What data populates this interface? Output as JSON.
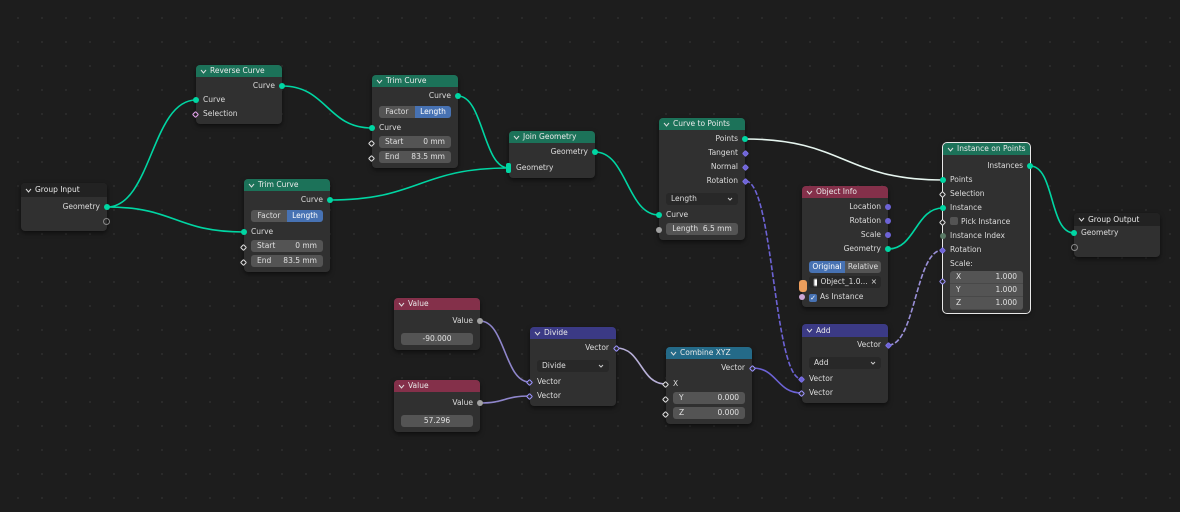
{
  "nodes": {
    "group_input": {
      "title": "Group Input",
      "outputs": [
        "Geometry"
      ]
    },
    "reverse_curve": {
      "title": "Reverse Curve",
      "output": "Curve",
      "inputs": [
        "Curve",
        "Selection"
      ]
    },
    "trim_curve_1": {
      "title": "Trim Curve",
      "output": "Curve",
      "modes": [
        "Factor",
        "Length"
      ],
      "mode_selected": "Length",
      "input": "Curve",
      "start": {
        "label": "Start",
        "value": "0 mm"
      },
      "end": {
        "label": "End",
        "value": "83.5 mm"
      }
    },
    "trim_curve_2": {
      "title": "Trim Curve",
      "output": "Curve",
      "modes": [
        "Factor",
        "Length"
      ],
      "mode_selected": "Length",
      "input": "Curve",
      "start": {
        "label": "Start",
        "value": "0 mm"
      },
      "end": {
        "label": "End",
        "value": "83.5 mm"
      }
    },
    "join_geometry": {
      "title": "Join Geometry",
      "output": "Geometry",
      "input": "Geometry"
    },
    "curve_to_points": {
      "title": "Curve to Points",
      "outputs": [
        "Points",
        "Tangent",
        "Normal",
        "Rotation"
      ],
      "mode": "Length",
      "input": "Curve",
      "length": {
        "label": "Length",
        "value": "6.5 mm"
      }
    },
    "object_info": {
      "title": "Object Info",
      "outputs": [
        "Location",
        "Rotation",
        "Scale",
        "Geometry"
      ],
      "modes": [
        "Original",
        "Relative"
      ],
      "mode_selected": "Original",
      "object": "Object_1.0...",
      "as_instance": {
        "label": "As Instance",
        "checked": true
      }
    },
    "instance_on_points": {
      "title": "Instance on Points",
      "output": "Instances",
      "inputs": [
        "Points",
        "Selection",
        "Instance",
        "Pick Instance",
        "Instance Index",
        "Rotation"
      ],
      "pick_instance_checked": false,
      "scale": {
        "label": "Scale:",
        "x": {
          "label": "X",
          "value": "1.000"
        },
        "y": {
          "label": "Y",
          "value": "1.000"
        },
        "z": {
          "label": "Z",
          "value": "1.000"
        }
      }
    },
    "group_output": {
      "title": "Group Output",
      "inputs": [
        "Geometry"
      ]
    },
    "value_1": {
      "title": "Value",
      "output": "Value",
      "value": "-90.000"
    },
    "value_2": {
      "title": "Value",
      "output": "Value",
      "value": "57.296"
    },
    "divide": {
      "title": "Divide",
      "output": "Vector",
      "operation": "Divide",
      "inputs": [
        "Vector",
        "Vector"
      ]
    },
    "combine_xyz": {
      "title": "Combine XYZ",
      "output": "Vector",
      "x_label": "X",
      "y": {
        "label": "Y",
        "value": "0.000"
      },
      "z": {
        "label": "Z",
        "value": "0.000"
      }
    },
    "add": {
      "title": "Add",
      "output": "Vector",
      "operation": "Add",
      "inputs": [
        "Vector",
        "Vector"
      ]
    }
  },
  "colors": {
    "background": "#1d1d1d",
    "node_body": "#303030",
    "geometry_header": "#1c7259",
    "input_header": "#84304a",
    "vector_header": "#3b3a85",
    "converter_header": "#246a88",
    "geometry_socket": "#00d6a3",
    "vector_socket": "#6d63d6",
    "float_socket": "#a1a1a1",
    "selected_button": "#4772b3"
  }
}
